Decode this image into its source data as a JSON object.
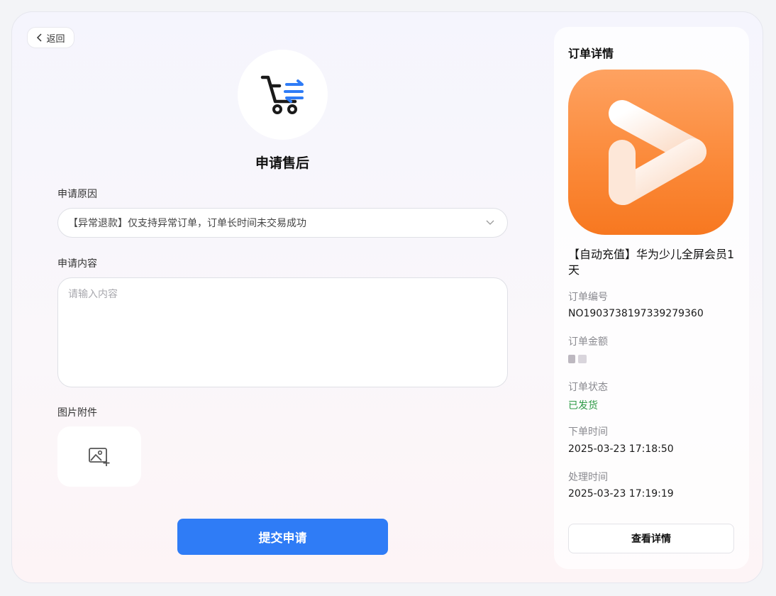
{
  "back": {
    "label": "返回"
  },
  "form": {
    "title": "申请售后",
    "reason_label": "申请原因",
    "reason_value": "【异常退款】仅支持异常订单，订单长时间未交易成功",
    "content_label": "申请内容",
    "content_placeholder": "请输入内容",
    "attachment_label": "图片附件",
    "submit_label": "提交申请"
  },
  "order": {
    "title": "订单详情",
    "product_name": "【自动充值】华为少儿全屏会员1天",
    "number_label": "订单编号",
    "number_value": "NO1903738197339279360",
    "amount_label": "订单金额",
    "status_label": "订单状态",
    "status_value": "已发货",
    "created_label": "下单时间",
    "created_value": "2025-03-23 17:18:50",
    "processed_label": "处理时间",
    "processed_value": "2025-03-23 17:19:19",
    "detail_button": "查看详情"
  },
  "colors": {
    "accent": "#2f7cf6",
    "status_green": "#2d9a45",
    "app_icon_orange": "#fb8a3a"
  },
  "icons": [
    "chevron-left-icon",
    "cart-icon",
    "chevron-down-icon",
    "image-add-icon",
    "app-play-icon"
  ]
}
